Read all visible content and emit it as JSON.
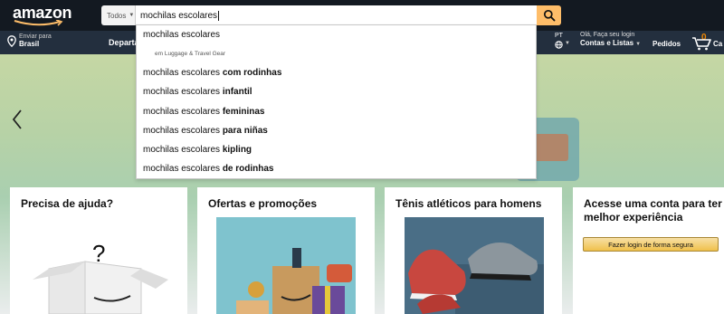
{
  "header": {
    "logo_text": "amazon",
    "search": {
      "category": "Todos",
      "query": "mochilas escolares",
      "button_icon": "search-icon"
    },
    "deliver": {
      "line1": "Enviar para",
      "line2": "Brasil"
    },
    "departments_label": "Departa",
    "language": "PT",
    "account": {
      "line1": "Olá, Faça seu login",
      "line2": "Contas e Listas"
    },
    "orders_label": "Pedidos",
    "cart": {
      "count": "0",
      "label": "Ca"
    }
  },
  "suggestions": {
    "first": "mochilas escolares",
    "department_hint": "em Luggage & Travel Gear",
    "items": [
      {
        "prefix": "mochilas escolares ",
        "suffix": "com rodinhas"
      },
      {
        "prefix": "mochilas escolares ",
        "suffix": "infantil"
      },
      {
        "prefix": "mochilas escolares ",
        "suffix": "femininas"
      },
      {
        "prefix": "mochilas escolares ",
        "suffix": "para niñas"
      },
      {
        "prefix": "mochilas escolares ",
        "suffix": "kipling"
      },
      {
        "prefix": "mochilas escolares ",
        "suffix": "de rodinhas"
      }
    ]
  },
  "cards": {
    "help": {
      "title": "Precisa de ajuda?"
    },
    "offers": {
      "title": "Ofertas e promoções"
    },
    "sneakers": {
      "title": "Tênis atléticos para homens"
    },
    "account": {
      "title": "Acesse uma conta para ter a melhor experiência",
      "button": "Fazer login de forma segura"
    }
  },
  "colors": {
    "nav_top": "#131921",
    "nav_bottom": "#232f3e",
    "search_button": "#febd69",
    "cart_count": "#f08804"
  }
}
